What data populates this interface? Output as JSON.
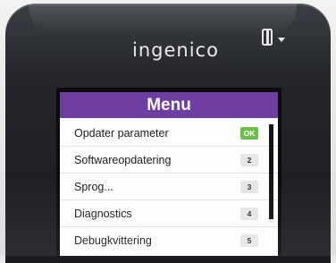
{
  "device": {
    "brand": "ingenico",
    "status_icon": "card-slot-dropdown-icon"
  },
  "screen": {
    "title": "Menu",
    "items": [
      {
        "label": "Opdater parameter",
        "badge": "OK"
      },
      {
        "label": "Softwareopdatering",
        "badge": "2"
      },
      {
        "label": "Sprog...",
        "badge": "3"
      },
      {
        "label": "Diagnostics",
        "badge": "4"
      },
      {
        "label": "Debugkvittering",
        "badge": "5"
      }
    ]
  },
  "colors": {
    "header": "#6f3ea1",
    "ok_badge": "#6cc04a",
    "device_body": "#23252a"
  }
}
